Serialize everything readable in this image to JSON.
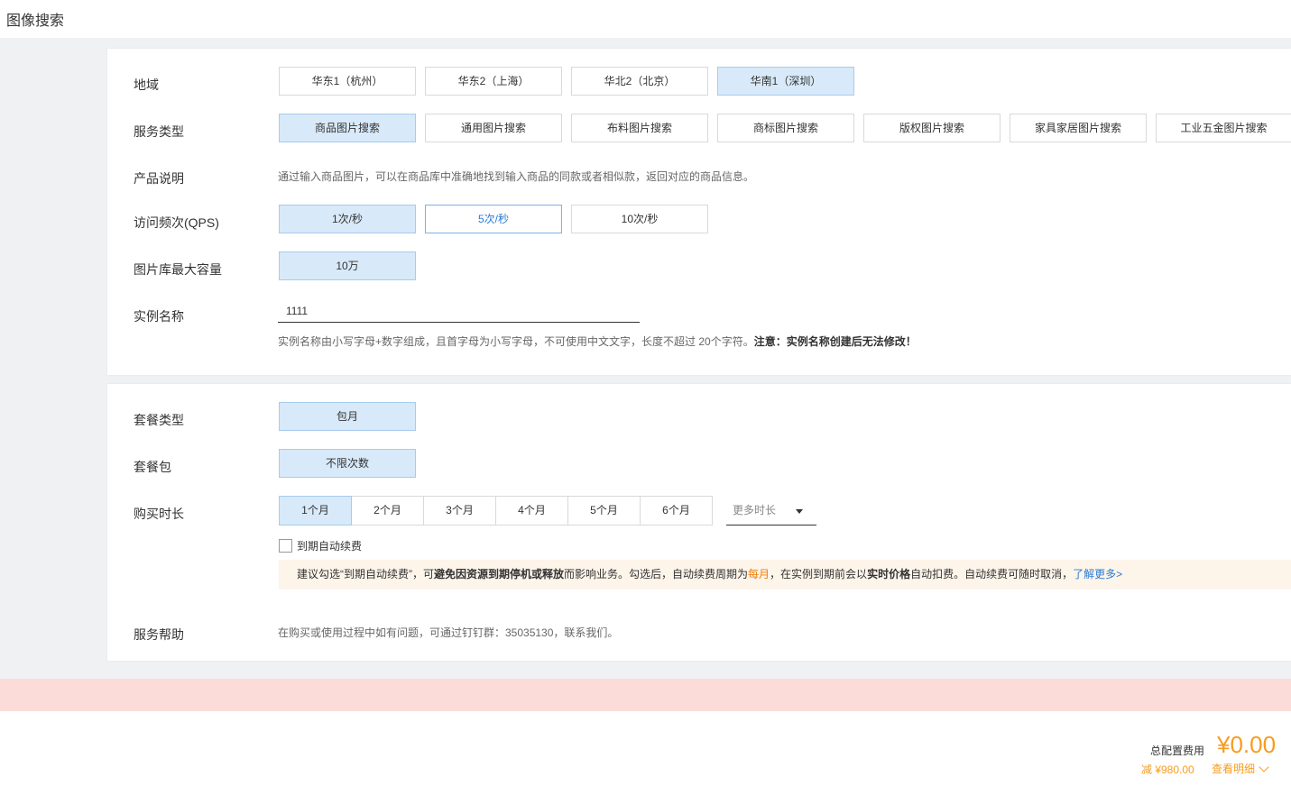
{
  "page": {
    "title": "图像搜索"
  },
  "region": {
    "label": "地域",
    "options": [
      "华东1（杭州）",
      "华东2（上海）",
      "华北2（北京）",
      "华南1（深圳）"
    ],
    "selected": "华南1（深圳）"
  },
  "service_type": {
    "label": "服务类型",
    "options": [
      "商品图片搜索",
      "通用图片搜索",
      "布料图片搜索",
      "商标图片搜索",
      "版权图片搜索",
      "家具家居图片搜索",
      "工业五金图片搜索"
    ],
    "selected": "商品图片搜索"
  },
  "product_desc": {
    "label": "产品说明",
    "text": "通过输入商品图片，可以在商品库中准确地找到输入商品的同款或者相似款，返回对应的商品信息。"
  },
  "qps": {
    "label": "访问频次(QPS)",
    "options": [
      "1次/秒",
      "5次/秒",
      "10次/秒"
    ],
    "selected": "1次/秒"
  },
  "capacity": {
    "label": "图片库最大容量",
    "options": [
      "10万"
    ],
    "selected": "10万"
  },
  "instance_name": {
    "label": "实例名称",
    "value": "1111",
    "hint": "实例名称由小写字母+数字组成，且首字母为小写字母，不可使用中文文字，长度不超过 20个字符。",
    "hint_bold": "注意：实例名称创建后无法修改！"
  },
  "package_type": {
    "label": "套餐类型",
    "options": [
      "包月"
    ],
    "selected": "包月"
  },
  "package": {
    "label": "套餐包",
    "options": [
      "不限次数"
    ],
    "selected": "不限次数"
  },
  "duration": {
    "label": "购买时长",
    "options": [
      "1个月",
      "2个月",
      "3个月",
      "4个月",
      "5个月",
      "6个月"
    ],
    "selected": "1个月",
    "more_placeholder": "更多时长"
  },
  "auto_renew": {
    "label": "到期自动续费",
    "checked": false
  },
  "notice": {
    "part1": "建议勾选“到期自动续费”，可",
    "bold1": "避免因资源到期停机或释放",
    "part2": "而影响业务。勾选后，自动续费周期为",
    "orange": "每月",
    "part3": "，在实例到期前会以",
    "bold2": "实时价格",
    "part4": "自动扣费。自动续费可随时取消，",
    "link": "了解更多>"
  },
  "help": {
    "label": "服务帮助",
    "text": "在购买或使用过程中如有问题，可通过钉钉群：35035130，联系我们。"
  },
  "footer": {
    "total_label": "总配置费用",
    "total_value": "¥0.00",
    "discount": "减 ¥980.00",
    "detail_link": "查看明细"
  },
  "colors": {
    "selected_bg": "#d8e9f9",
    "accent_blue": "#2b7cd3",
    "price_orange": "#f79c1f",
    "notice_bg": "#fdf4ea",
    "pink_bar": "#fcdcd8"
  }
}
